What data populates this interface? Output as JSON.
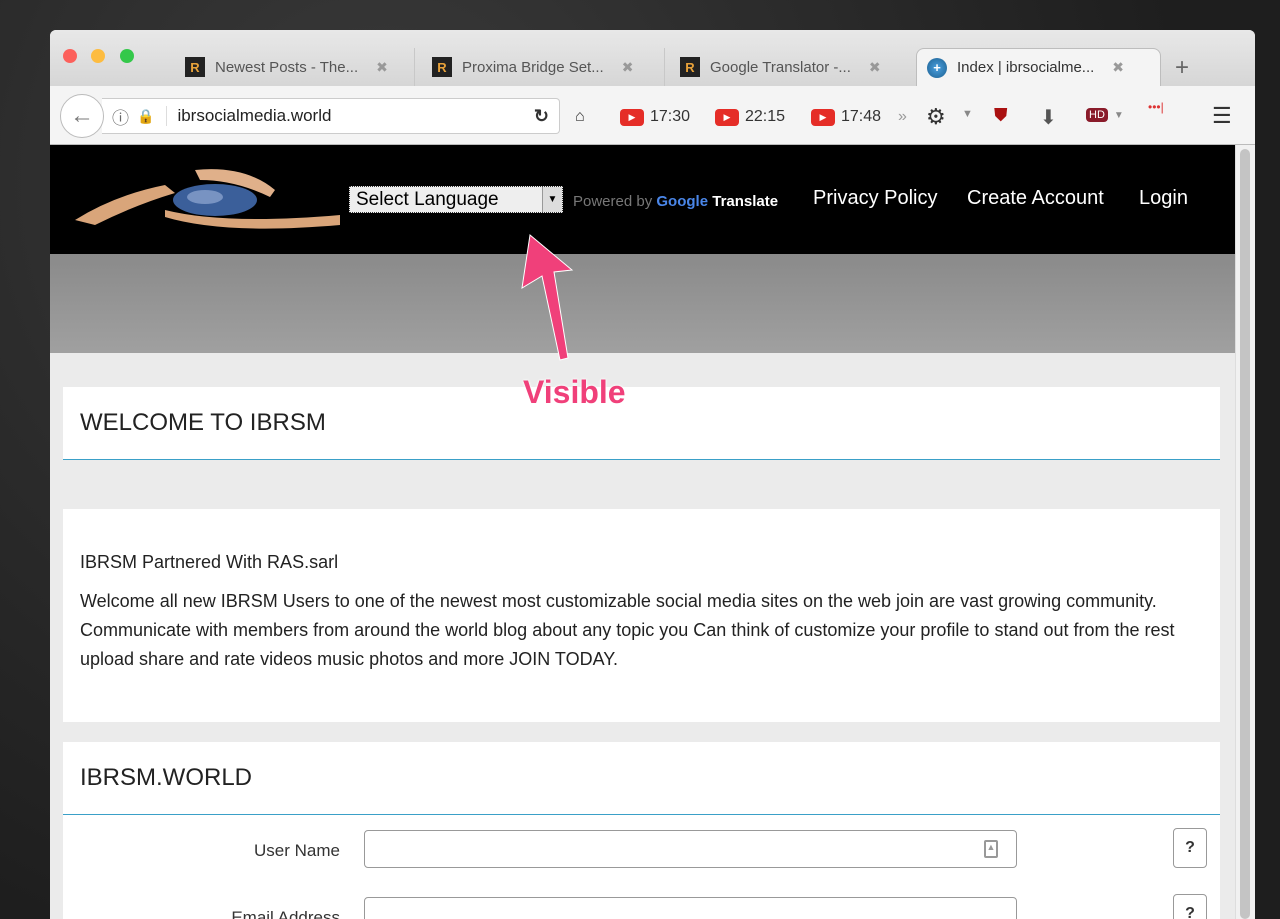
{
  "browser": {
    "tabs": [
      {
        "title": "Newest Posts - The...",
        "active": false
      },
      {
        "title": "Proxima Bridge Set...",
        "active": false
      },
      {
        "title": "Google Translator -...",
        "active": false
      },
      {
        "title": "Index | ibrsocialme...",
        "active": true
      }
    ],
    "url": "ibrsocialmedia.world",
    "bookmarks": [
      "17:30",
      "22:15",
      "17:48"
    ],
    "icons": [
      "back-icon",
      "info-icon",
      "insecure-lock-icon",
      "reload-icon",
      "home-icon",
      "overflow-icon",
      "settings-icon",
      "ublock-icon",
      "download-icon",
      "hd-icon",
      "menu-icon"
    ]
  },
  "header": {
    "language_select": "Select Language",
    "powered_by": "Powered by",
    "google": "Google",
    "translate": "Translate",
    "nav": [
      "Privacy Policy",
      "Create Account",
      "Login"
    ]
  },
  "annotation": {
    "text": "Visible",
    "color": "#f0407a"
  },
  "welcome": {
    "title": "WELCOME TO IBRSM"
  },
  "intro": {
    "line1": "IBRSM Partnered With RAS.sarl",
    "body": "Welcome all new IBRSM Users to one of the newest most customizable social media sites on the web join are vast growing community. Communicate with members from around the world blog about any topic you Can think of customize your profile to stand out from the rest upload share and rate videos music photos and more JOIN TODAY."
  },
  "form": {
    "title": "IBRSM.WORLD",
    "fields": [
      {
        "label": "User Name",
        "value": ""
      },
      {
        "label": "Email Address",
        "value": ""
      }
    ],
    "help": "?"
  }
}
